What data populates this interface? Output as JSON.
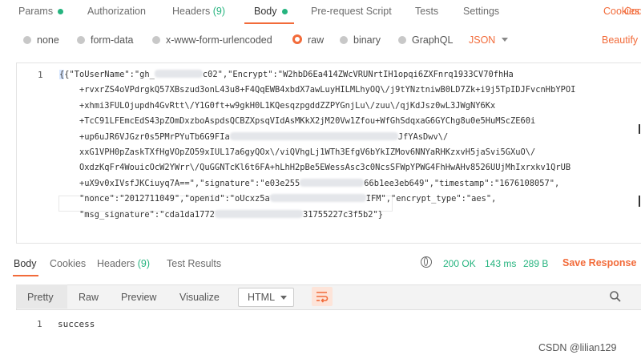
{
  "request_tabs": [
    {
      "label": "Params"
    },
    {
      "label": "Authorization"
    },
    {
      "label": "Headers",
      "count": "(9)"
    },
    {
      "label": "Body"
    },
    {
      "label": "Pre-request Script"
    },
    {
      "label": "Tests"
    },
    {
      "label": "Settings"
    }
  ],
  "cookies_label": "Cookies",
  "code_label": "Code",
  "body_types": [
    "none",
    "form-data",
    "x-www-form-urlencoded",
    "raw",
    "binary",
    "GraphQL"
  ],
  "raw_format": "JSON",
  "beautify_label": "Beautify",
  "editor": {
    "line_number": "1",
    "lines": [
      "{\"ToUserName\":\"gh_",
      "c02\",\"Encrypt\":\"W2hbD6Ea414ZWcVRUNrtIH1opqi6ZXFnrq1933CV70fhHa",
      "+rvxrZS4oVPdrgkQ57XBszud3onL43u8+F4QqEWB4xbdX7awLuyHILMLhyOQ\\/j9tYNztniwB0LD7Zk+i9j5TpIDJFvcnHbYPOI",
      "+xhmi3FULOjupdh4GvRtt\\/Y1G0ft+w9gkH0L1KQesqzpgddZZPYGnjLu\\/zuu\\/qjKdJsz0wL3JWgNY6Kx",
      "+TcC91LFEmcEdS43pZOmDxzboAspdsQCBZXpsqVIdAsMKkX2jM20Vw1Zfou+WfGhSdqxaG6GYChg8u0e5HuMScZE60i",
      "+up6uJR6VJGzr0s5PMrPYuTb6G9FIa",
      "JfYAsDwv\\/",
      "xxG1VPH0pZaskTXfHgVOpZO59xIUL17a6gyQOx\\/viQVhgLj1WTh3EfgV6bYkIZMov6NNYaRHKzxvH5jaSvi5GXuO\\/",
      "OxdzKqFr4WouicOcW2YWrr\\/QuGGNTcKl6t6FA+hLhH2pBe5EWessAsc3c0NcsSFWpYPWG4FhHwAHv8526UUjMhIxrxkv1QrUB",
      "+uX9v0xIVsfJKCiuyq7A==\",\"signature\":\"e03e255",
      "66b1ee3eb649\",\"timestamp\":\"1676108057\",",
      "\"nonce\":\"2012711049\",\"openid\":\"oUcxz5a",
      "IFM\",\"encrypt_type\":\"aes\",",
      "\"msg_signature\":\"cda1da1772",
      "31755227c3f5b2\"}"
    ]
  },
  "response_tabs": [
    {
      "label": "Body"
    },
    {
      "label": "Cookies"
    },
    {
      "label": "Headers",
      "count": "(9)"
    },
    {
      "label": "Test Results"
    }
  ],
  "response_status": {
    "status": "200 OK",
    "time": "143 ms",
    "size": "289 B"
  },
  "save_response_label": "Save Response",
  "view_modes": [
    "Pretty",
    "Raw",
    "Preview",
    "Visualize"
  ],
  "response_format": "HTML",
  "response_line_number": "1",
  "response_body": "success",
  "watermark": "CSDN @lilian129",
  "colors": {
    "accent": "#f26b3a",
    "success": "#26b47f"
  }
}
